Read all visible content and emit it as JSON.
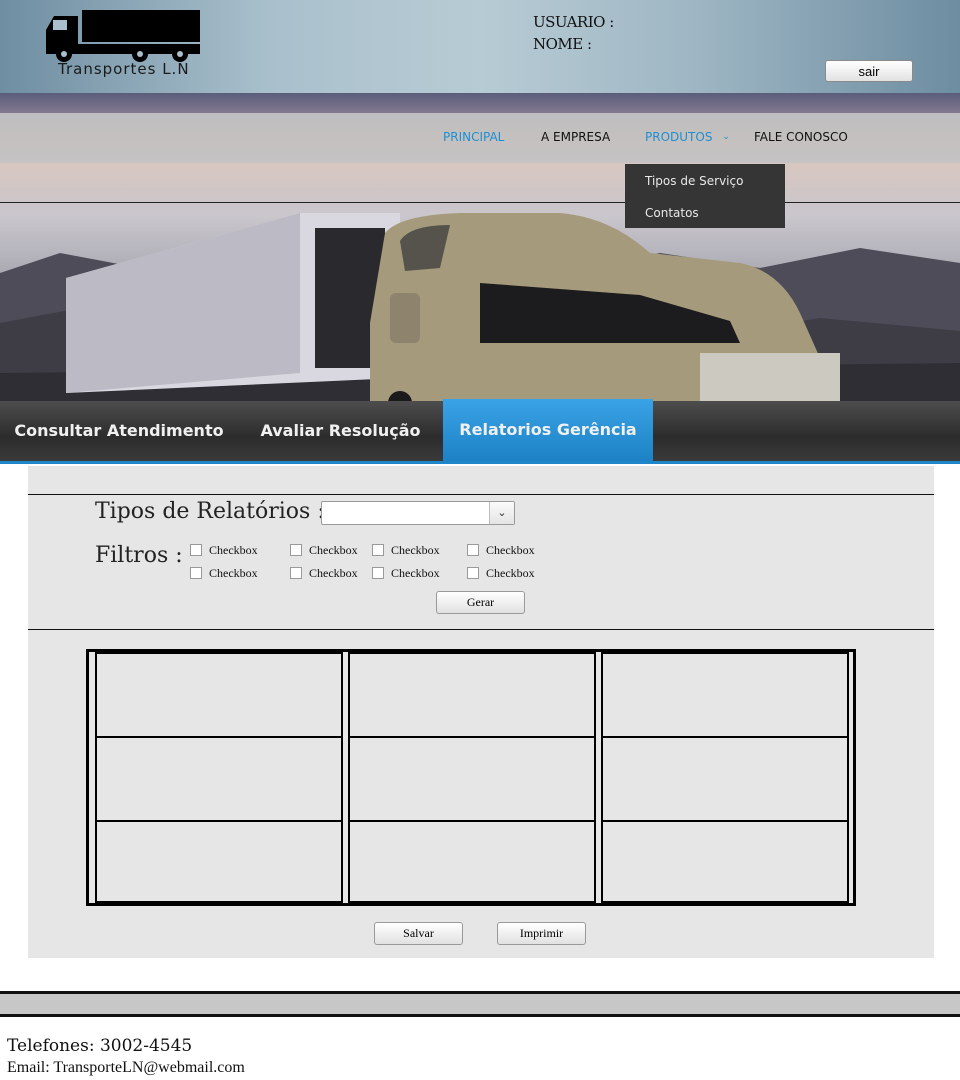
{
  "header": {
    "logo_text": "Transportes L.N",
    "user_label": "USUARIO :",
    "name_label": "NOME :",
    "logout_label": "sair"
  },
  "nav": {
    "items": [
      "PRINCIPAL",
      "A EMPRESA",
      "PRODUTOS",
      "FALE CONOSCO"
    ],
    "active": "PRINCIPAL",
    "highlight_color": "#1f8fd1",
    "dropdown": [
      "Tipos de Serviço",
      "Contatos"
    ]
  },
  "tabs": {
    "items": [
      "Consultar Atendimento",
      "Avaliar Resolução",
      "Relatorios Gerência"
    ],
    "active": "Relatorios Gerência",
    "active_color": "#2a92d6"
  },
  "report": {
    "types_label": "Tipos de Relatórios :",
    "types_value": "",
    "filters_label": "Filtros :",
    "checkboxes": [
      "Checkbox",
      "Checkbox",
      "Checkbox",
      "Checkbox",
      "Checkbox",
      "Checkbox",
      "Checkbox",
      "Checkbox"
    ],
    "generate_label": "Gerar"
  },
  "actions": {
    "save_label": "Salvar",
    "print_label": "Imprimir"
  },
  "footer": {
    "phone": "Telefones: 3002-4545",
    "email": "Email: TransporteLN@webmail.com"
  }
}
